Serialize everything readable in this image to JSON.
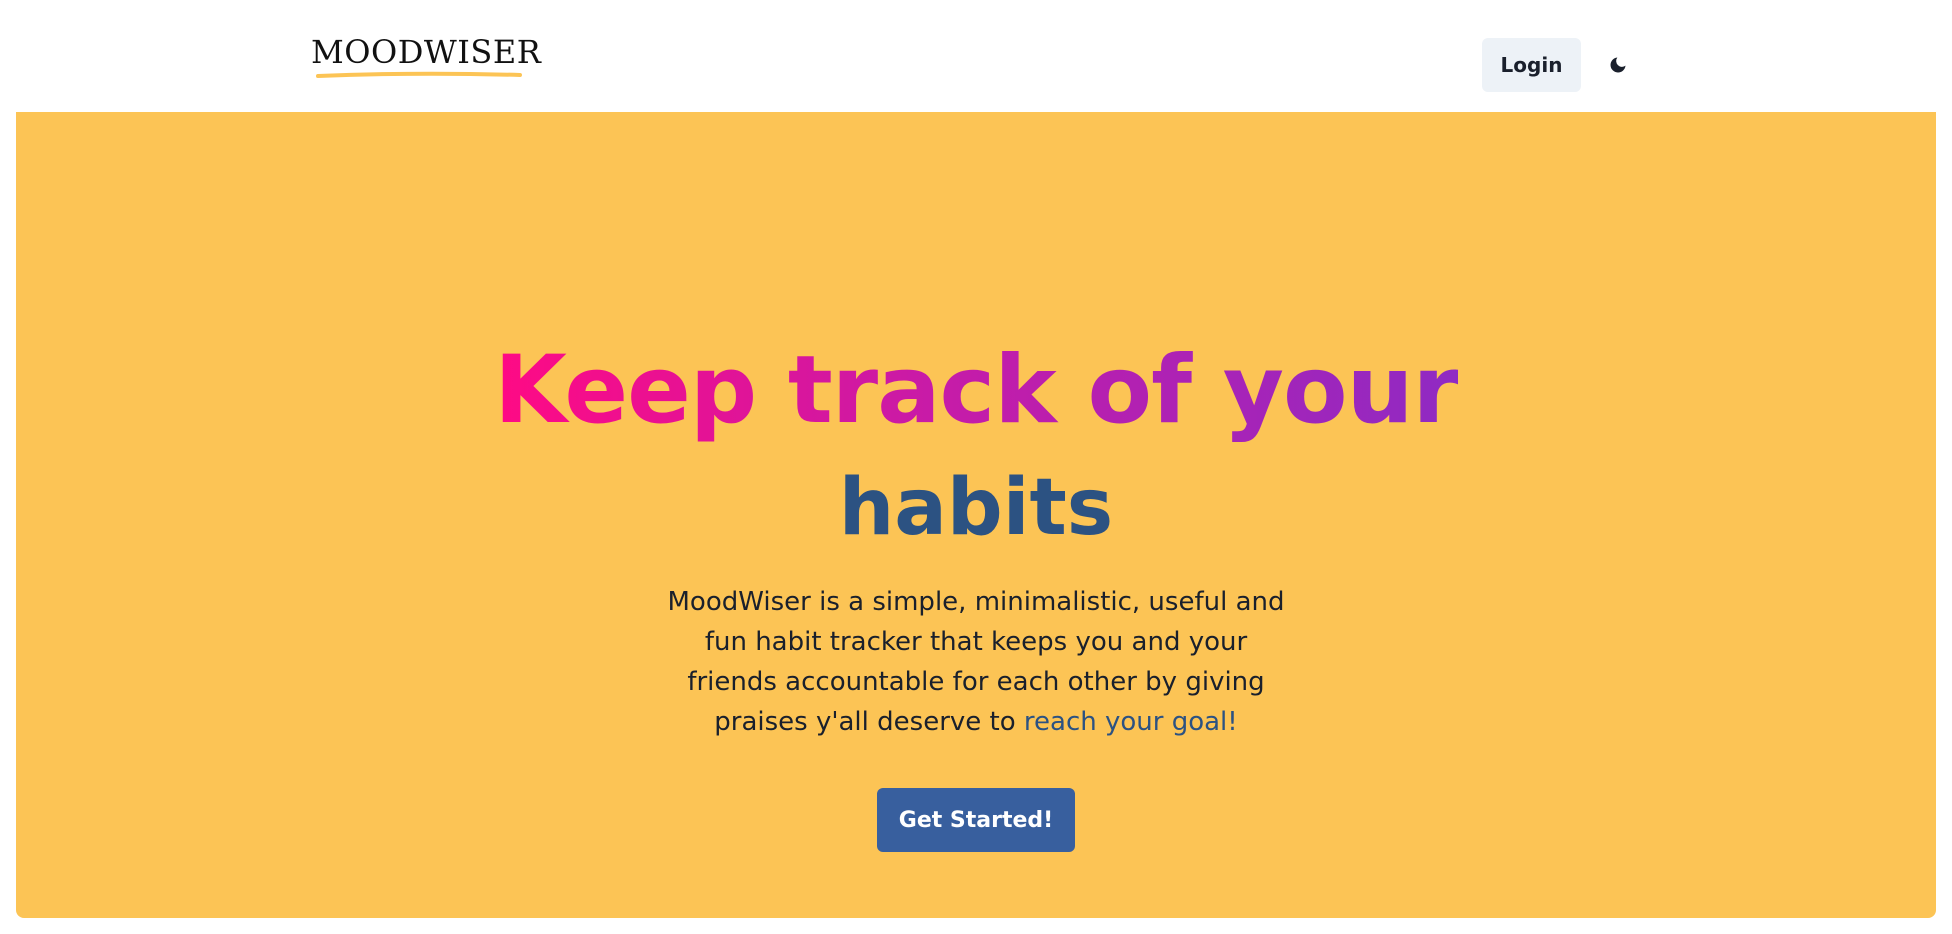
{
  "navbar": {
    "logo": "MOODWISER",
    "login_label": "Login",
    "theme_toggle_icon": "moon-icon"
  },
  "hero": {
    "headline_line1": "Keep track of your",
    "headline_line2": "habits",
    "description_text": "MoodWiser is a simple, minimalistic, useful and fun habit tracker that keeps you and your friends accountable for each other by giving praises y'all deserve to ",
    "description_link": "reach your goal!",
    "cta_label": "Get Started!"
  },
  "colors": {
    "hero_background": "#fcc455",
    "gradient_start": "#ff0a84",
    "gradient_end": "#8f2ac3",
    "accent_blue": "#2c5282",
    "cta_background": "#385f9e",
    "logo_underline": "#fcc455"
  }
}
